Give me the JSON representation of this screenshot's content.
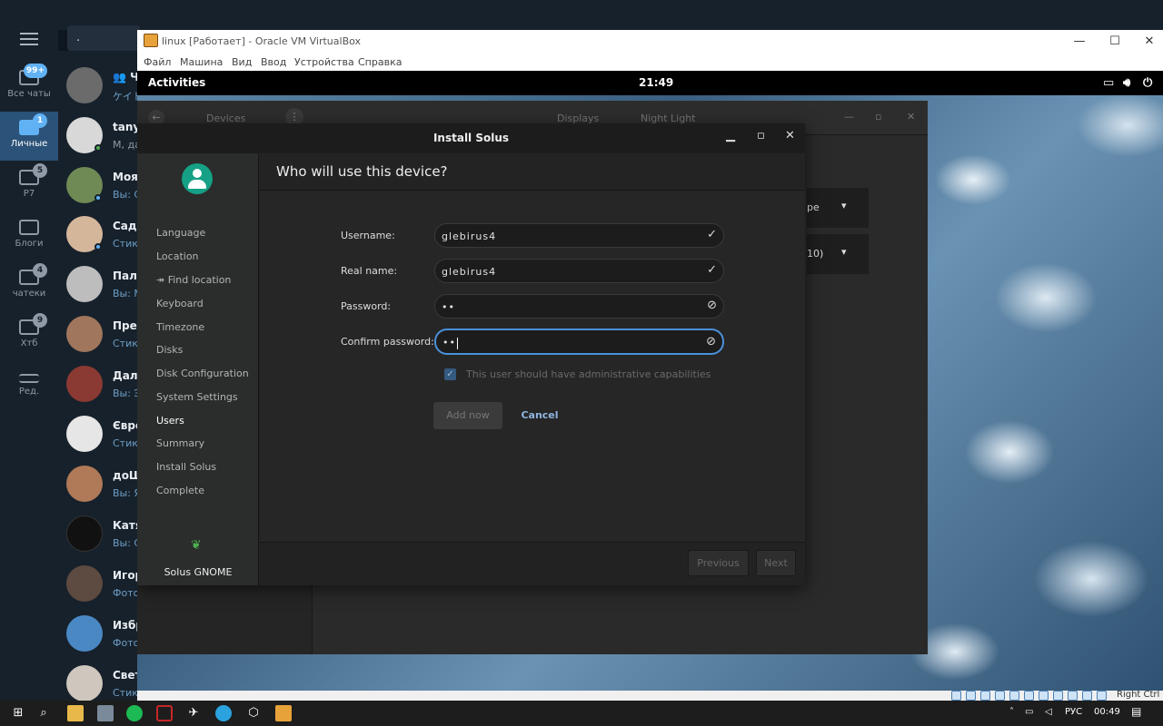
{
  "telegram": {
    "search_text": ".",
    "folders": [
      {
        "label": "Все чаты",
        "badge": "99+"
      },
      {
        "label": "Личные",
        "badge": "1"
      },
      {
        "label": "Р7",
        "badge": "5"
      },
      {
        "label": "Блоги",
        "badge": ""
      },
      {
        "label": "чатеки",
        "badge": "4"
      },
      {
        "label": "Хтб",
        "badge": "9"
      },
      {
        "label": "Ред.",
        "badge": ""
      }
    ],
    "chats": [
      {
        "name": "👥 Ч",
        "preview": "ケイト"
      },
      {
        "name": "tanya",
        "preview": "M, да"
      },
      {
        "name": "Моя",
        "preview": "Вы: С"
      },
      {
        "name": "Сади",
        "preview": "Стик"
      },
      {
        "name": "Пала",
        "preview": "Вы: М"
      },
      {
        "name": "Пред",
        "preview": "Стик"
      },
      {
        "name": "Далг",
        "preview": "Вы: Э"
      },
      {
        "name": "Євро",
        "preview": "Стик"
      },
      {
        "name": "доШ",
        "preview": "Вы: Я"
      },
      {
        "name": "Катя",
        "preview": "Вы: С"
      },
      {
        "name": "Игор",
        "preview": "Фото"
      },
      {
        "name": "Избр",
        "preview": "Фото"
      },
      {
        "name": "Свет",
        "preview": "Стик"
      }
    ]
  },
  "virtualbox": {
    "title": "linux [Работает] - Oracle VM VirtualBox",
    "menu": [
      "Файл",
      "Машина",
      "Вид",
      "Ввод",
      "Устройства",
      "Справка"
    ],
    "host_key": "Right Ctrl"
  },
  "guest": {
    "activities": "Activities",
    "clock": "21:49",
    "settings": {
      "panel_title": "Devices",
      "tabs": [
        "Displays",
        "Night Light"
      ],
      "dropdown1": "pe",
      "dropdown2": "10)"
    },
    "installer": {
      "title": "Install Solus",
      "header": "Who will use this device?",
      "steps": [
        "Language",
        "Location",
        "↠ Find location",
        "Keyboard",
        "Timezone",
        "Disks",
        "Disk Configuration",
        "System Settings",
        "Users",
        "Summary",
        "Install Solus",
        "Complete"
      ],
      "current_step": "Users",
      "brand": "Solus GNOME",
      "form": {
        "username_label": "Username:",
        "username_value": "glebirus4",
        "realname_label": "Real name:",
        "realname_value": "glebirus4",
        "password_label": "Password:",
        "password_value": "••",
        "confirm_label": "Confirm password:",
        "confirm_value": "••",
        "admin_label": "This user should have administrative capabilities",
        "add_button": "Add now",
        "cancel_button": "Cancel"
      },
      "previous_button": "Previous",
      "next_button": "Next"
    }
  },
  "taskbar": {
    "language": "РУС",
    "time": "00:49"
  }
}
